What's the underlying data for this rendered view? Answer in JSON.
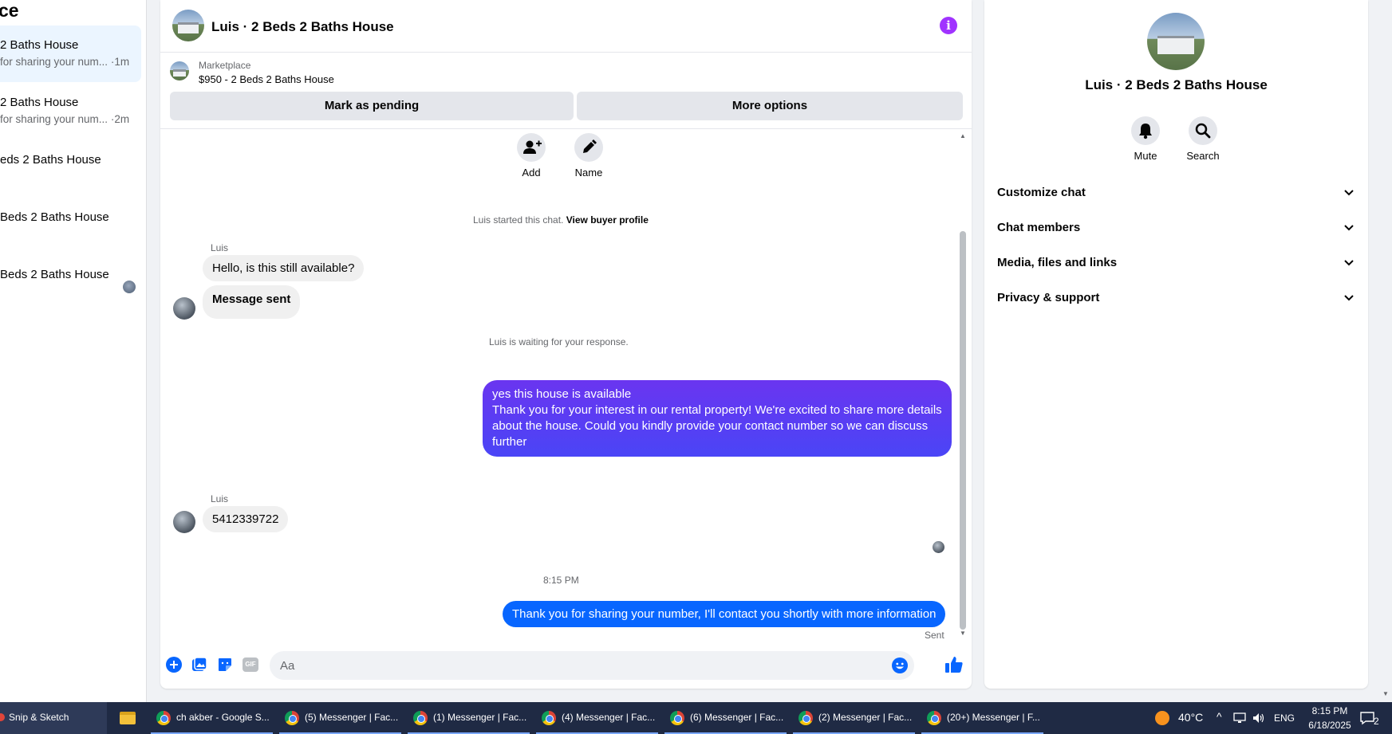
{
  "sidebar": {
    "title": "ce",
    "conversations": [
      {
        "title": "2 Baths House",
        "snippet": "for sharing your num...",
        "time": "·1m",
        "active": true
      },
      {
        "title": "2 Baths House",
        "snippet": "for sharing your num...",
        "time": "·2m"
      },
      {
        "title": "eds 2 Baths House",
        "snippet": ""
      },
      {
        "title": "Beds 2 Baths House",
        "snippet": ""
      },
      {
        "title": " Beds 2 Baths House",
        "snippet": ""
      }
    ]
  },
  "chat": {
    "title": "Luis · 2 Beds 2 Baths House",
    "marketplace_label": "Marketplace",
    "item": "$950 - 2 Beds 2 Baths House",
    "mark_pending": "Mark as pending",
    "more_options": "More options",
    "add_label": "Add",
    "name_label": "Name",
    "started_text": "Luis started this chat.",
    "view_profile": "View buyer profile",
    "sender_name": "Luis",
    "msg_in_1": "Hello, is this still available?",
    "msg_in_2": "Message sent",
    "waiting_text": "Luis is waiting for your response.",
    "msg_out_1_line1": "yes this house is available",
    "msg_out_1_line2": "Thank you for your interest in our rental property! We're excited to share more details about the house. Could you kindly provide your contact number so we can discuss further",
    "msg_in_3": "5412339722",
    "timestamp": "8:15 PM",
    "msg_out_2": "Thank you for sharing your number, I'll contact you shortly with more information",
    "sent_status": "Sent",
    "composer_placeholder": "Aa",
    "gif_label": "GIF"
  },
  "info_panel": {
    "name": "Luis · 2 Beds 2 Baths House",
    "mute": "Mute",
    "search": "Search",
    "sections": [
      "Customize chat",
      "Chat members",
      "Media, files and links",
      "Privacy & support"
    ]
  },
  "taskbar": {
    "items": [
      {
        "label": "Snip & Sketch"
      },
      {
        "label": "ch akber - Google S..."
      },
      {
        "label": "(5) Messenger | Fac..."
      },
      {
        "label": "(1) Messenger | Fac..."
      },
      {
        "label": "(4) Messenger | Fac..."
      },
      {
        "label": "(6) Messenger | Fac..."
      },
      {
        "label": "(2) Messenger | Fac..."
      },
      {
        "label": "(20+) Messenger | F..."
      }
    ],
    "temperature": "40°C",
    "language": "ENG",
    "time": "8:15 PM",
    "date": "6/18/2025",
    "notifications": "2"
  },
  "colors": {
    "accent_blue": "#0866ff",
    "purple_bubble": "#5b3cf5",
    "info_purple": "#a033ff"
  }
}
